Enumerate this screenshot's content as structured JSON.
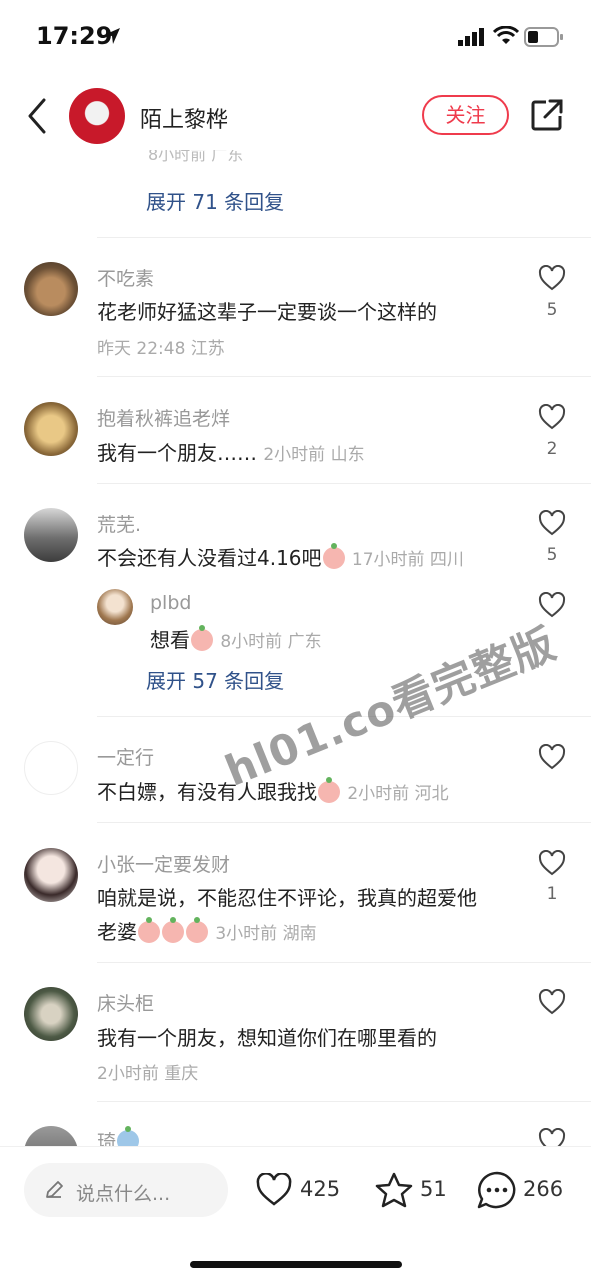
{
  "status": {
    "time": "17:29"
  },
  "header": {
    "name": "陌上黎桦",
    "follow_label": "关注"
  },
  "top_meta": "8小时前 广东",
  "expand1": "展开 71 条回复",
  "expand2": "展开 57 条回复",
  "comments": [
    {
      "user": "不吃素",
      "text": "花老师好猛这辈子一定要谈一个这样的",
      "meta": "昨天 22:48 江苏",
      "likes": "5"
    },
    {
      "user": "抱着秋裤追老烊",
      "text": "我有一个朋友……",
      "meta": "2小时前 山东",
      "likes": "2"
    },
    {
      "user": "荒芜.",
      "text": "不会还有人没看过4.16吧",
      "meta": "17小时前 四川",
      "likes": "5"
    },
    {
      "user": "plbd",
      "text": "想看",
      "meta": "8小时前 广东",
      "likes": ""
    },
    {
      "user": "一定行",
      "text": "不白嫖，有没有人跟我找",
      "meta": "2小时前 河北",
      "likes": ""
    },
    {
      "user": "小张一定要发财",
      "text_line1": "咱就是说，不能忍住不评论，我真的超爱他",
      "text_line2": "老婆",
      "meta": "3小时前 湖南",
      "likes": "1"
    },
    {
      "user": "床头柜",
      "text": "我有一个朋友，想知道你们在哪里看的",
      "meta": "2小时前 重庆",
      "likes": ""
    },
    {
      "user": "琦",
      "text": "",
      "meta": "",
      "likes": ""
    }
  ],
  "watermark": "hl01.co看完整版",
  "bottom": {
    "placeholder": "说点什么...",
    "likes": "425",
    "stars": "51",
    "comments": "266"
  }
}
